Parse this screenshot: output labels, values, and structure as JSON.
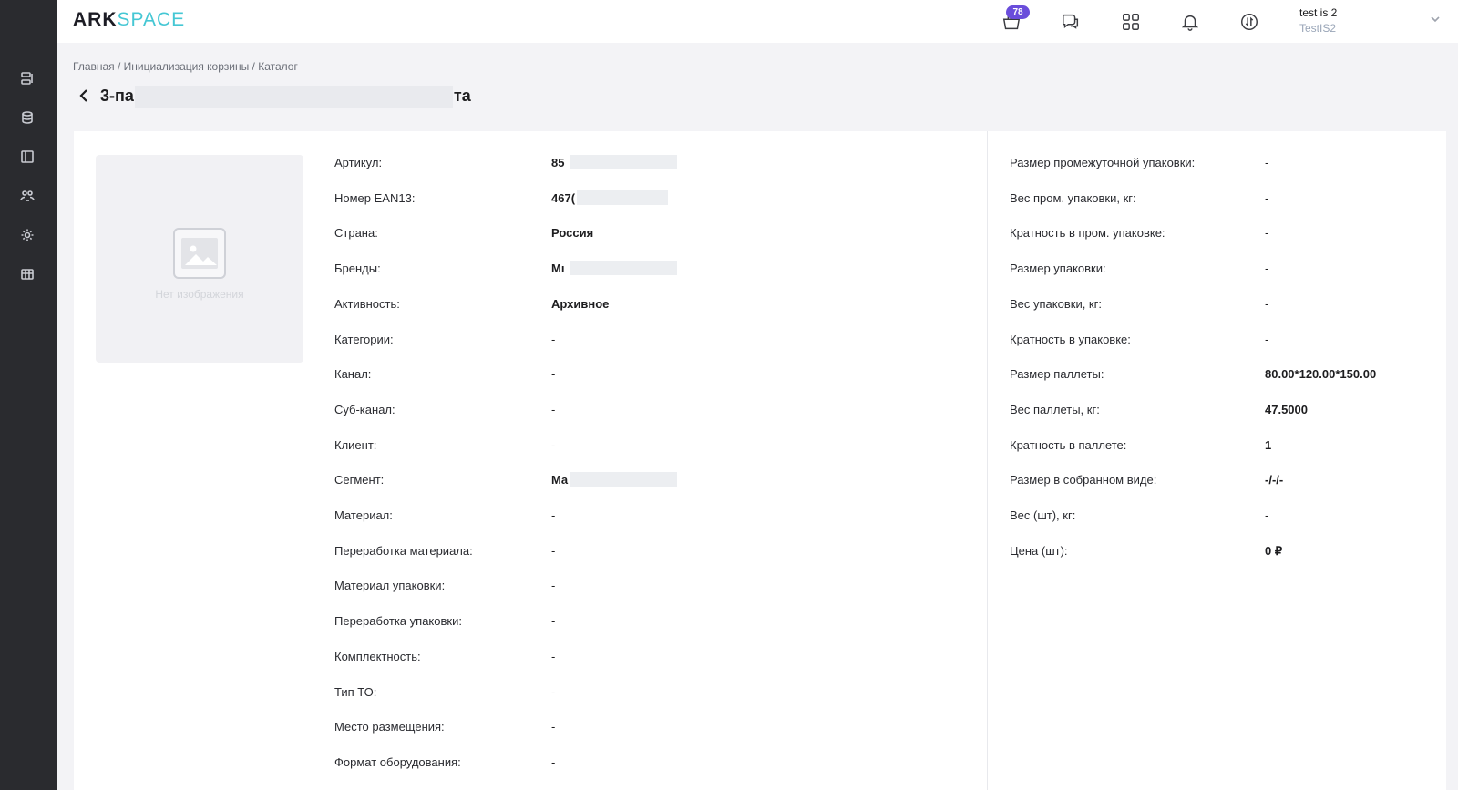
{
  "brand": {
    "part1": "ARK",
    "part2": "SPACE"
  },
  "header": {
    "cart_badge": "78",
    "user_name": "test is 2",
    "user_org": "TestIS2"
  },
  "breadcrumb": "Главная / Инициализация корзины / Каталог",
  "title": {
    "prefix": "3-па",
    "suffix": "та"
  },
  "image": {
    "placeholder": "Нет изображения"
  },
  "left_fields": [
    {
      "label": "Артикул:",
      "value": "85"
    },
    {
      "label": "Номер EAN13:",
      "value": "467("
    },
    {
      "label": "Страна:",
      "value": "Россия"
    },
    {
      "label": "Бренды:",
      "value": "Mı"
    },
    {
      "label": "Активность:",
      "value": "Архивное"
    },
    {
      "label": "Категории:",
      "value": "-"
    },
    {
      "label": "Канал:",
      "value": "-"
    },
    {
      "label": "Суб-канал:",
      "value": "-"
    },
    {
      "label": "Клиент:",
      "value": "-"
    },
    {
      "label": "Сегмент:",
      "value": "Ma"
    },
    {
      "label": "Материал:",
      "value": "-"
    },
    {
      "label": "Переработка материала:",
      "value": "-"
    },
    {
      "label": "Материал упаковки:",
      "value": "-"
    },
    {
      "label": "Переработка упаковки:",
      "value": "-"
    },
    {
      "label": "Комплектность:",
      "value": "-"
    },
    {
      "label": "Тип ТО:",
      "value": "-"
    },
    {
      "label": "Место размещения:",
      "value": "-"
    },
    {
      "label": "Формат оборудования:",
      "value": "-"
    }
  ],
  "right_fields": [
    {
      "label": "Размер промежуточной упаковки:",
      "value": "-"
    },
    {
      "label": "Вес пром. упаковки, кг:",
      "value": "-"
    },
    {
      "label": "Кратность в пром. упаковке:",
      "value": "-"
    },
    {
      "label": "Размер упаковки:",
      "value": "-"
    },
    {
      "label": "Вес упаковки, кг:",
      "value": "-"
    },
    {
      "label": "Кратность в упаковке:",
      "value": "-"
    },
    {
      "label": "Размер паллеты:",
      "value": "80.00*120.00*150.00"
    },
    {
      "label": "Вес паллеты, кг:",
      "value": "47.5000"
    },
    {
      "label": "Кратность в паллете:",
      "value": "1"
    },
    {
      "label": "Размер в собранном виде:",
      "value": "-/-/-"
    },
    {
      "label": "Вес (шт), кг:",
      "value": "-"
    },
    {
      "label": "Цена (шт):",
      "value": "0 ₽"
    }
  ]
}
